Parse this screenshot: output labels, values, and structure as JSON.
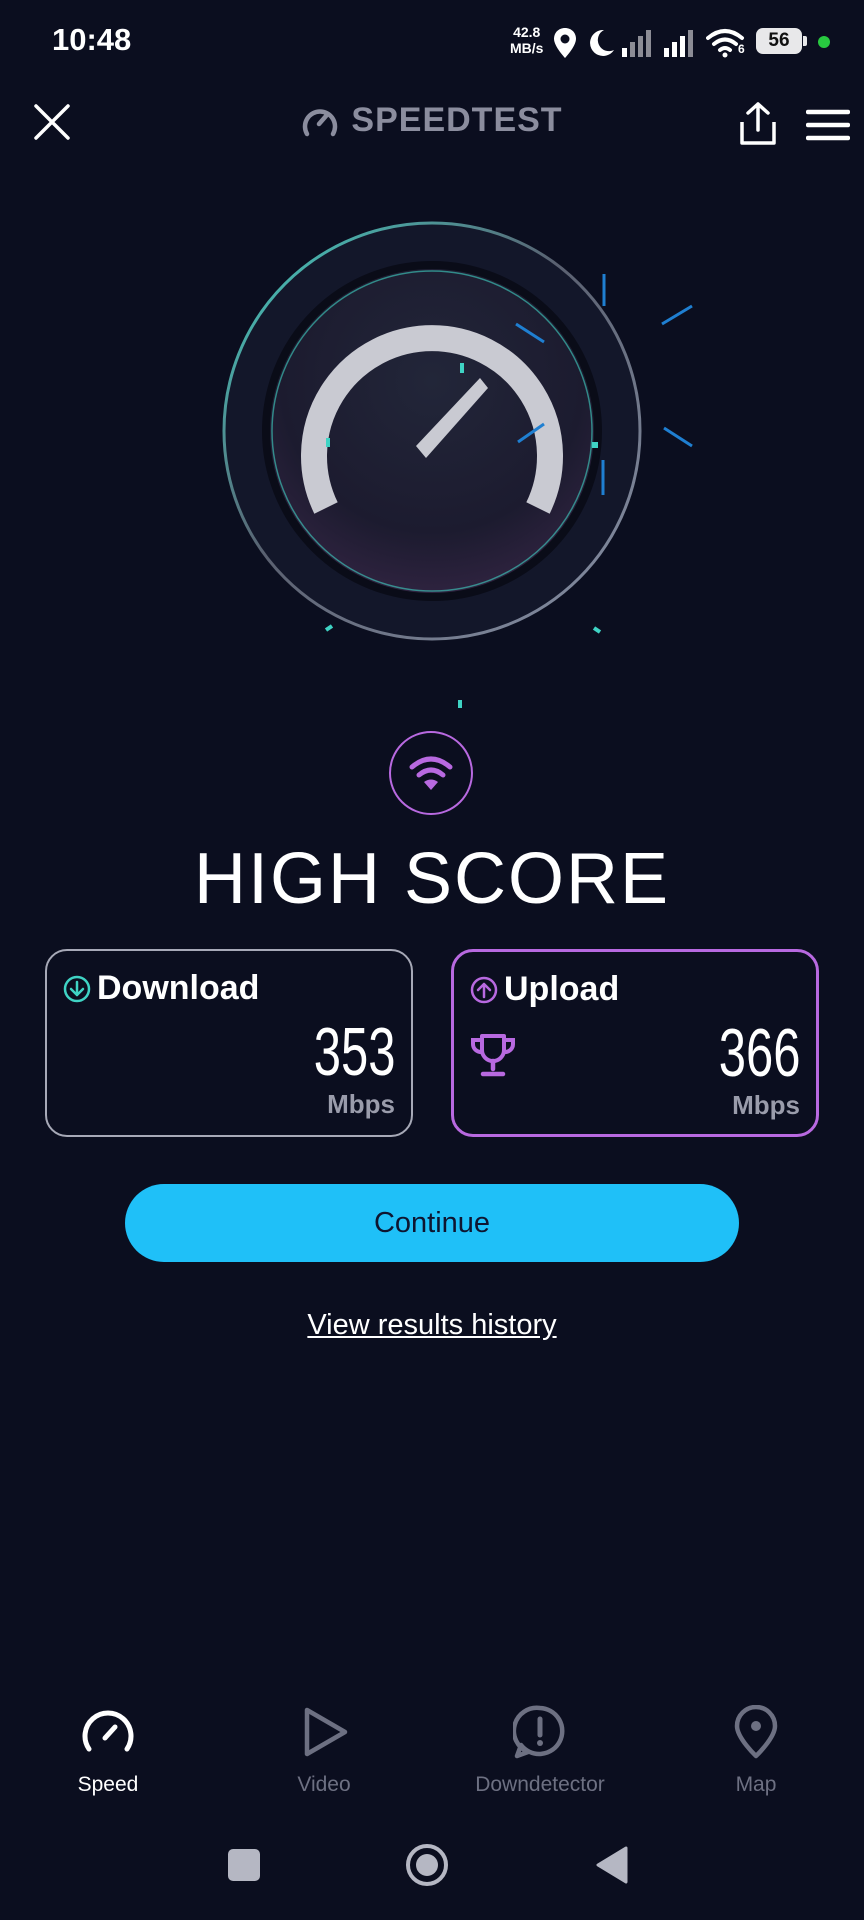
{
  "status_bar": {
    "time": "10:48",
    "net_rate_value": "42.8",
    "net_rate_unit": "MB/s",
    "battery": "56",
    "signal_sub": "6",
    "icons": [
      "location-icon",
      "moon-icon",
      "signal-icon",
      "signal-icon",
      "wifi-icon",
      "battery-icon"
    ]
  },
  "header": {
    "title": "SPEEDTEST",
    "icons": [
      "close-icon",
      "gauge-logo-icon",
      "share-icon",
      "menu-icon"
    ]
  },
  "result": {
    "heading": "HIGH SCORE",
    "connection_icon": "wifi-icon"
  },
  "download": {
    "label": "Download",
    "value": "353",
    "unit": "Mbps",
    "icon": "download-arrow-icon"
  },
  "upload": {
    "label": "Upload",
    "value": "366",
    "unit": "Mbps",
    "icon": "upload-arrow-icon",
    "badge_icon": "trophy-icon"
  },
  "actions": {
    "continue_label": "Continue",
    "history_label": "View results history"
  },
  "bottom_nav": [
    {
      "label": "Speed",
      "icon": "speed-icon",
      "active": true
    },
    {
      "label": "Video",
      "icon": "play-icon",
      "active": false
    },
    {
      "label": "Downdetector",
      "icon": "alert-icon",
      "active": false
    },
    {
      "label": "Map",
      "icon": "map-pin-icon",
      "active": false
    }
  ],
  "colors": {
    "background": "#0b0e1f",
    "accent_cyan": "#1fc0f8",
    "accent_purple": "#b869e0",
    "teal": "#3fd3c4",
    "muted": "#6d7082"
  }
}
